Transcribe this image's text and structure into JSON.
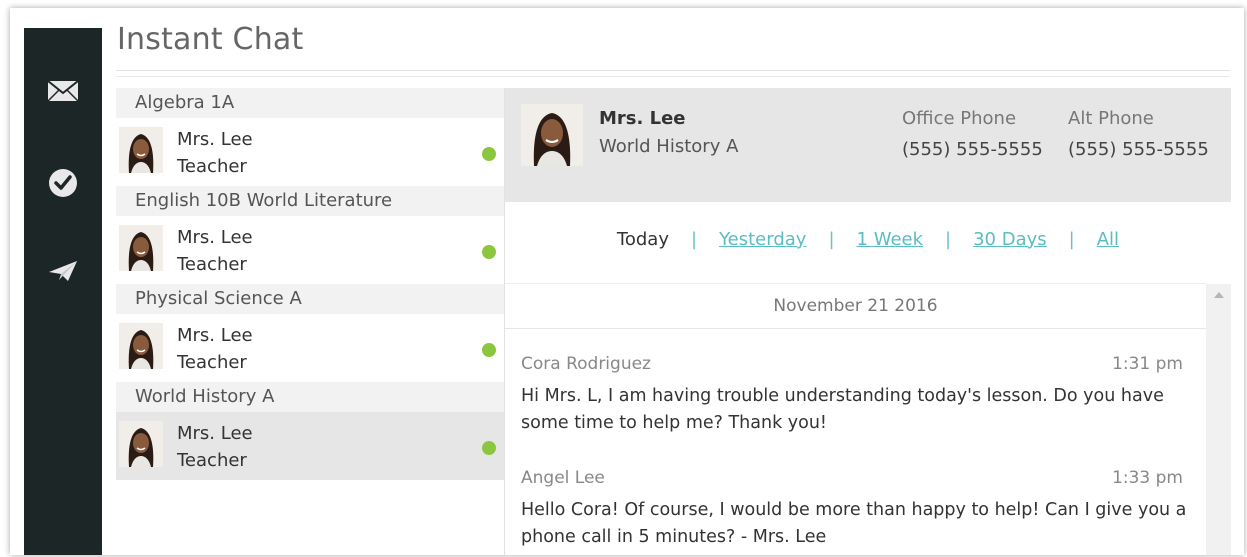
{
  "app": {
    "title": "Instant Chat"
  },
  "sidebar": {
    "icons": [
      {
        "name": "mail-icon"
      },
      {
        "name": "check-circle-icon"
      },
      {
        "name": "paper-plane-icon"
      }
    ]
  },
  "contacts": {
    "groups": [
      {
        "course": "Algebra 1A",
        "name": "Mrs. Lee",
        "role": "Teacher",
        "online": true,
        "selected": false
      },
      {
        "course": "English 10B World Literature",
        "name": "Mrs. Lee",
        "role": "Teacher",
        "online": true,
        "selected": false
      },
      {
        "course": "Physical Science A",
        "name": "Mrs. Lee",
        "role": "Teacher",
        "online": true,
        "selected": false
      },
      {
        "course": "World History A",
        "name": "Mrs. Lee",
        "role": "Teacher",
        "online": true,
        "selected": true
      }
    ]
  },
  "profile": {
    "name": "Mrs. Lee",
    "course": "World History A",
    "office_phone_label": "Office Phone",
    "office_phone": "(555) 555-5555",
    "alt_phone_label": "Alt Phone",
    "alt_phone": "(555) 555-5555"
  },
  "filters": {
    "today": "Today",
    "yesterday": "Yesterday",
    "week": "1 Week",
    "days30": "30 Days",
    "all": "All",
    "separator": "|"
  },
  "conversation": {
    "date": "November 21 2016",
    "messages": [
      {
        "sender": "Cora Rodriguez",
        "time": "1:31 pm",
        "text": "Hi Mrs. L, I am having trouble understanding today's lesson. Do you have some time to help me? Thank you!"
      },
      {
        "sender": "Angel Lee",
        "time": "1:33 pm",
        "text": "Hello Cora! Of course, I would be more than happy to help! Can I give you a phone call in 5 minutes? - Mrs. Lee"
      }
    ]
  },
  "colors": {
    "sidebar_bg": "#1c2626",
    "online": "#8cc63f",
    "link": "#5bbcc6",
    "selected_bg": "#e6e6e6"
  }
}
